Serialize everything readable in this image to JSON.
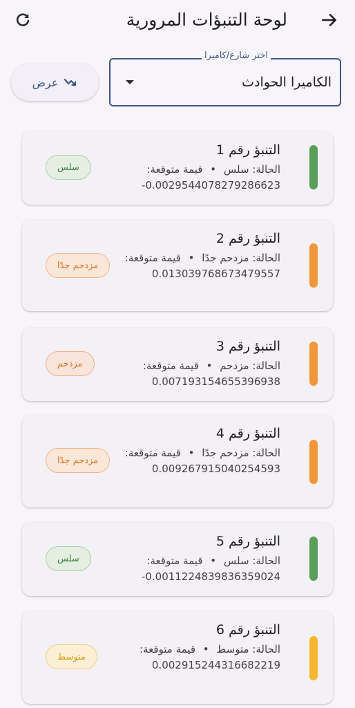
{
  "header": {
    "title": "لوحة التنبؤات المرورية",
    "back_icon": "arrow-forward-icon",
    "refresh_icon": "refresh-icon"
  },
  "filter": {
    "label": "اختر شارع/كاميرا",
    "value": "الكاميرا الحوادث",
    "caret_icon": "caret-down-icon",
    "show_button_label": "عرض",
    "show_button_icon": "trend-down-icon"
  },
  "status_colors": {
    "smooth": "#5a9e5a",
    "crowded": "#f2963a",
    "very_crowded": "#f2963a",
    "medium": "#f5b731"
  },
  "predictions": [
    {
      "title": "التنبؤ رقم 1",
      "status_prefix": "الحالة:",
      "status": "سلس",
      "dot": "•",
      "expected_label": "قيمة متوقعة:",
      "value": "-0.0029544078279286623",
      "badge": "سلس"
    },
    {
      "title": "التنبؤ رقم 2",
      "status_prefix": "الحالة:",
      "status": "مزدحم جدًا",
      "dot": "•",
      "expected_label": "قيمة متوقعة:",
      "value": "0.013039768673479557",
      "badge": "مزدحم جدًا"
    },
    {
      "title": "التنبؤ رقم 3",
      "status_prefix": "الحالة:",
      "status": "مزدحم",
      "dot": "•",
      "expected_label": "قيمة متوقعة:",
      "value": "0.007193154655396938",
      "badge": "مزدحم"
    },
    {
      "title": "التنبؤ رقم 4",
      "status_prefix": "الحالة:",
      "status": "مزدحم جدًا",
      "dot": "•",
      "expected_label": "قيمة متوقعة:",
      "value": "0.009267915040254593",
      "badge": "مزدحم جدًا"
    },
    {
      "title": "التنبؤ رقم 5",
      "status_prefix": "الحالة:",
      "status": "سلس",
      "dot": "•",
      "expected_label": "قيمة متوقعة:",
      "value": "-0.0011224839836359024",
      "badge": "سلس"
    },
    {
      "title": "التنبؤ رقم 6",
      "status_prefix": "الحالة:",
      "status": "متوسط",
      "dot": "•",
      "expected_label": "قيمة متوقعة:",
      "value": "0.002915244316682219",
      "badge": "متوسط"
    }
  ]
}
